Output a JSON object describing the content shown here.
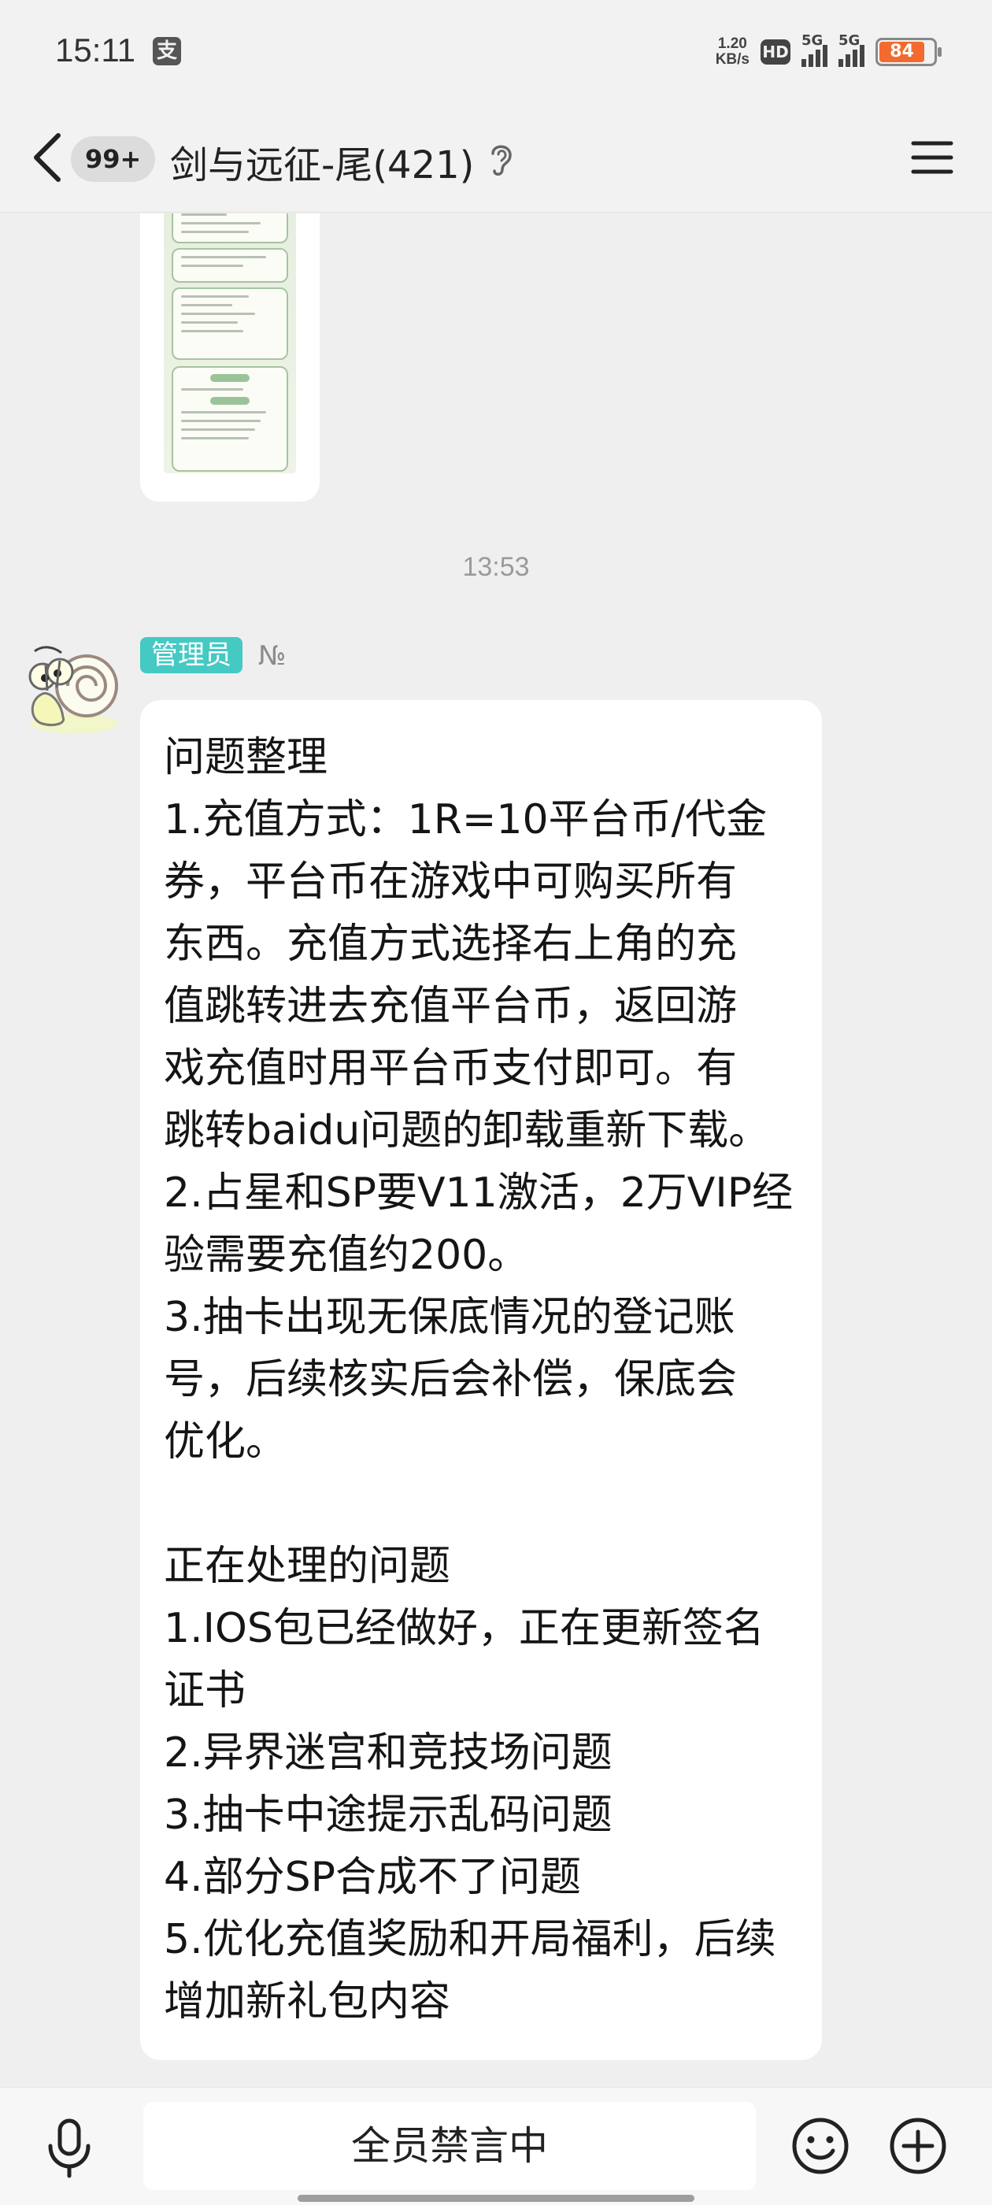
{
  "status_bar": {
    "time": "15:11",
    "pay_icon": "支",
    "net_speed_value": "1.20",
    "net_speed_unit": "KB/s",
    "hd_label": "HD",
    "signal1_label": "5G",
    "signal2_label": "5G",
    "battery_level": "84",
    "battery_color": "#f26a2e"
  },
  "header": {
    "unread_count": "99+",
    "title": "剑与远征-尾(421)",
    "icons": [
      "back-chevron-icon",
      "ear-icon",
      "menu-icon"
    ]
  },
  "chat": {
    "time_divider": "13:53",
    "sender": {
      "role": "管理员",
      "name": "№",
      "role_color": "#45c9c3"
    },
    "message_lines": [
      "问题整理",
      "1.充值方式：1R=10平台币/代金",
      "券，平台币在游戏中可购买所有",
      "东西。充值方式选择右上角的充",
      "值跳转进去充值平台币，返回游",
      "戏充值时用平台币支付即可。有",
      "跳转baidu问题的卸载重新下载。",
      "2.占星和SP要V11激活，2万VIP经",
      "验需要充值约200。",
      "3.抽卡出现无保底情况的登记账",
      "号，后续核实后会补偿，保底会",
      "优化。",
      "",
      "正在处理的问题",
      "1.IOS包已经做好，正在更新签名",
      "证书",
      "2.异界迷宫和竞技场问题",
      "3.抽卡中途提示乱码问题",
      "4.部分SP合成不了问题",
      "5.优化充值奖励和开局福利，后续",
      "增加新礼包内容"
    ]
  },
  "input_bar": {
    "muted_text": "全员禁言中",
    "icons": [
      "microphone-icon",
      "emoji-icon",
      "plus-icon"
    ]
  }
}
